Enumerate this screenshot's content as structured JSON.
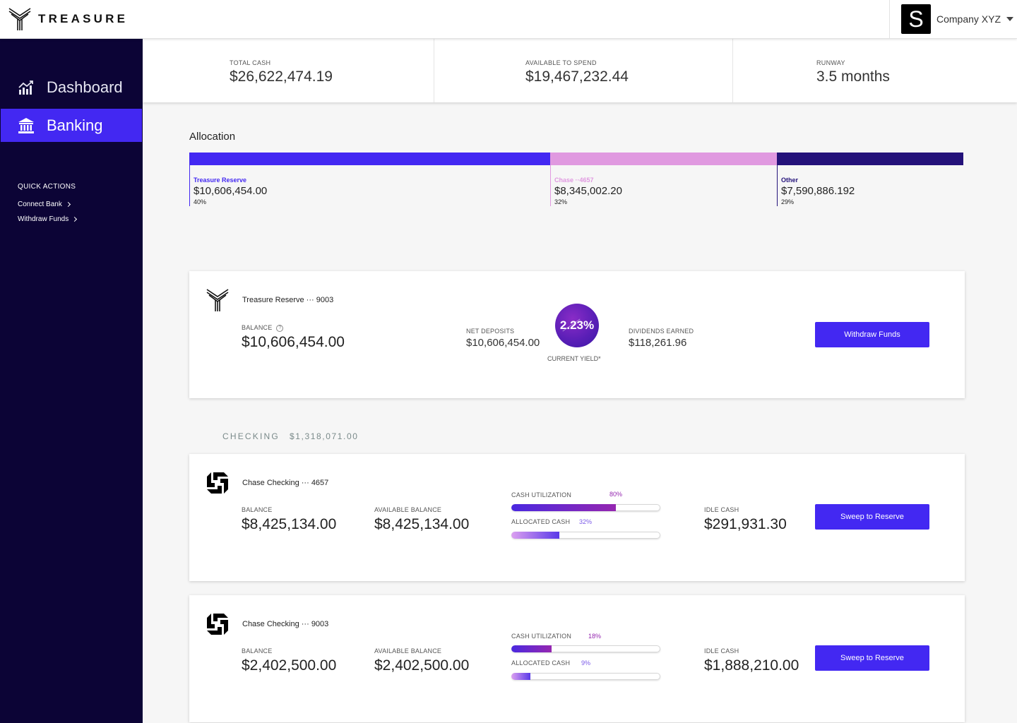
{
  "app": {
    "brand": "TREASURE"
  },
  "company": {
    "avatar_letter": "S",
    "name": "Company XYZ"
  },
  "sidebar": {
    "nav": [
      {
        "label": "Dashboard",
        "icon": "chart-bars-icon",
        "active": false
      },
      {
        "label": "Banking",
        "icon": "bank-icon",
        "active": true
      }
    ],
    "quick_actions_title": "QUICK ACTIONS",
    "quick_actions": [
      {
        "label": "Connect Bank"
      },
      {
        "label": "Withdraw Funds"
      }
    ]
  },
  "summary": [
    {
      "label": "TOTAL CASH",
      "value": "$26,622,474.19"
    },
    {
      "label": "AVAILABLE TO SPEND",
      "value": "$19,467,232.44"
    },
    {
      "label": "RUNWAY",
      "value": "3.5 months"
    }
  ],
  "allocation": {
    "title": "Allocation",
    "segments": [
      {
        "name": "Treasure Reserve",
        "amount": "$10,606,454.00",
        "pct": "40%",
        "fraction": 0.466,
        "color": "#4328f2",
        "name_color": "#4328f2"
      },
      {
        "name": "Chase ··4657",
        "amount": "$8,345,002.20",
        "pct": "32%",
        "fraction": 0.293,
        "color": "#e099e0",
        "name_color": "#e099e0"
      },
      {
        "name": "Other",
        "amount": "$7,590,886.192",
        "pct": "29%",
        "fraction": 0.241,
        "color": "#24127a",
        "name_color": "#24127a"
      }
    ]
  },
  "reserve_card": {
    "title": "Treasure Reserve ··· 9003",
    "balance_label": "BALANCE",
    "help_glyph": "?",
    "balance": "$10,606,454.00",
    "net_deposits_label": "NET DEPOSITS",
    "net_deposits": "$10,606,454.00",
    "yield": "2.23%",
    "yield_label": "CURRENT YIELD*",
    "dividends_label": "DIVIDENDS EARNED",
    "dividends": "$118,261.96",
    "button": "Withdraw Funds"
  },
  "checking_section": {
    "label": "CHECKING",
    "total": "$1,318,071.00"
  },
  "checking_accounts": [
    {
      "title": "Chase Checking ··· 4657",
      "balance_label": "BALANCE",
      "balance": "$8,425,134.00",
      "available_label": "AVAILABLE BALANCE",
      "available": "$8,425,134.00",
      "util_label": "CASH UTILIZATION",
      "util_pct": "80%",
      "util_fraction": 0.7,
      "alloc_label": "ALLOCATED CASH",
      "alloc_pct": "32%",
      "alloc_fraction": 0.32,
      "idle_label": "IDLE CASH",
      "idle": "$291,931.30",
      "button": "Sweep to Reserve"
    },
    {
      "title": "Chase Checking ··· 9003",
      "balance_label": "BALANCE",
      "balance": "$2,402,500.00",
      "available_label": "AVAILABLE BALANCE",
      "available": "$2,402,500.00",
      "util_label": "CASH UTILIZATION",
      "util_pct": "18%",
      "util_fraction": 0.27,
      "alloc_label": "ALLOCATED CASH",
      "alloc_pct": "9%",
      "alloc_fraction": 0.13,
      "idle_label": "IDLE CASH",
      "idle": "$1,888,210.00",
      "button": "Sweep to Reserve"
    }
  ]
}
